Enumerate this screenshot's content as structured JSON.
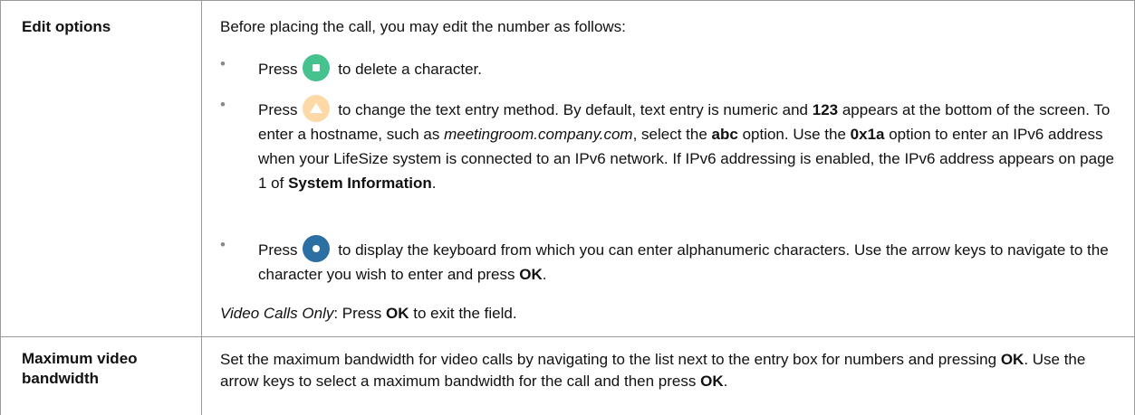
{
  "rows": [
    {
      "label": "Edit options",
      "intro": "Before placing the call, you may edit the number as follows:",
      "bullet1": {
        "press": "Press",
        "rest": "to delete a character.",
        "icon": "green-square-button-icon"
      },
      "bullet2": {
        "press": "Press",
        "t1": "to change the text entry method. By default, text entry is numeric and",
        "b1": "123",
        "t2": "appears at the bottom of the screen. To enter a hostname, such as",
        "i1": "meetingroom.company.com",
        "t3": ", select the",
        "b2": "abc",
        "t4": "option. Use the",
        "b3": "0x1a",
        "t5": "option to enter an IPv6 address when your LifeSize system is connected to an IPv6 network. If IPv6 addressing is enabled, the IPv6 address appears on page 1 of",
        "b4": "System Information",
        "t6": ".",
        "icon": "amber-triangle-button-icon"
      },
      "bullet3": {
        "press": "Press",
        "t1": "to display the keyboard from which you can enter alphanumeric characters. Use the arrow keys to navigate to the character you wish to enter and press",
        "b1": "OK",
        "t2": ".",
        "icon": "blue-circle-button-icon"
      },
      "footer": {
        "i1": "Video Calls Only",
        "t1": ": Press",
        "b1": "OK",
        "t2": "to exit the field."
      }
    },
    {
      "label_line1": "Maximum video",
      "label_line2": "bandwidth",
      "t1": "Set the maximum bandwidth for video calls by navigating to the list next to the entry box for numbers and pressing",
      "b1": "OK",
      "t2": ". Use the arrow keys to select a maximum bandwidth for the call and then press",
      "b2": "OK",
      "t3": "."
    }
  ],
  "colors": {
    "border": "#9a9a9a",
    "green": "#45c28d",
    "amber": "#fdd9a8",
    "blue": "#2b6fa3"
  }
}
